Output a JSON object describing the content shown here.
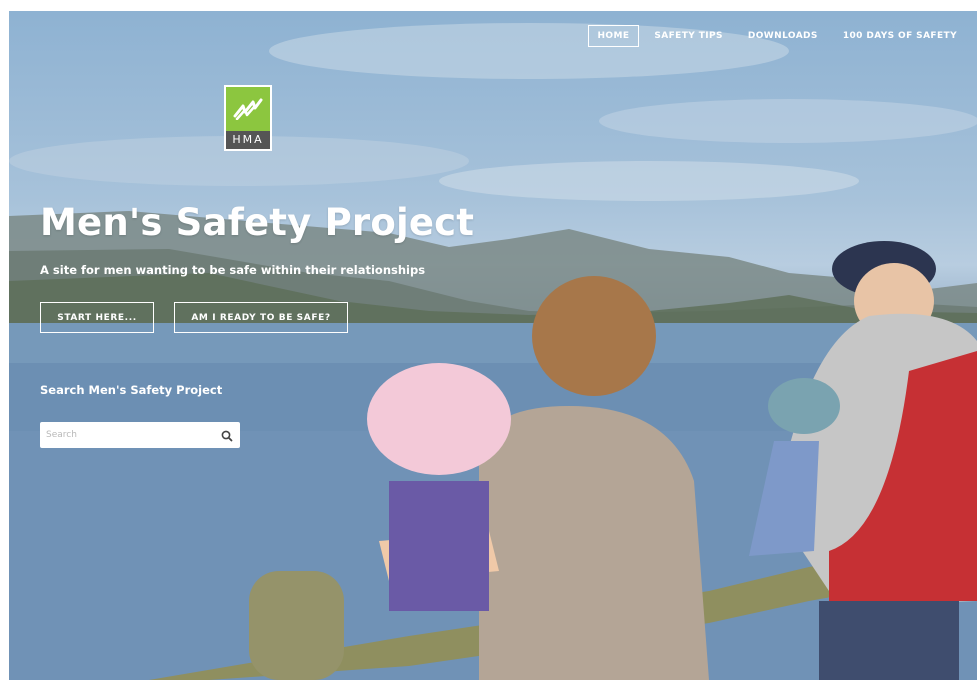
{
  "nav": {
    "items": [
      {
        "label": "HOME",
        "active": true
      },
      {
        "label": "SAFETY TIPS",
        "active": false
      },
      {
        "label": "DOWNLOADS",
        "active": false
      },
      {
        "label": "100 DAYS OF SAFETY",
        "active": false
      }
    ]
  },
  "logo": {
    "text": "HMA",
    "colors": {
      "mark": "#8cc63f",
      "band": "#555555"
    }
  },
  "hero": {
    "title": "Men's Safety Project",
    "subtitle": "A site for men wanting to be safe within their relationships",
    "buttons": [
      {
        "label": "START HERE..."
      },
      {
        "label": "AM I READY TO BE SAFE?"
      }
    ]
  },
  "search": {
    "heading": "Search Men's Safety Project",
    "placeholder": "Search",
    "value": "",
    "icon": "search-icon"
  },
  "colors": {
    "text": "#ffffff",
    "nav_active_border": "#ffffff"
  }
}
